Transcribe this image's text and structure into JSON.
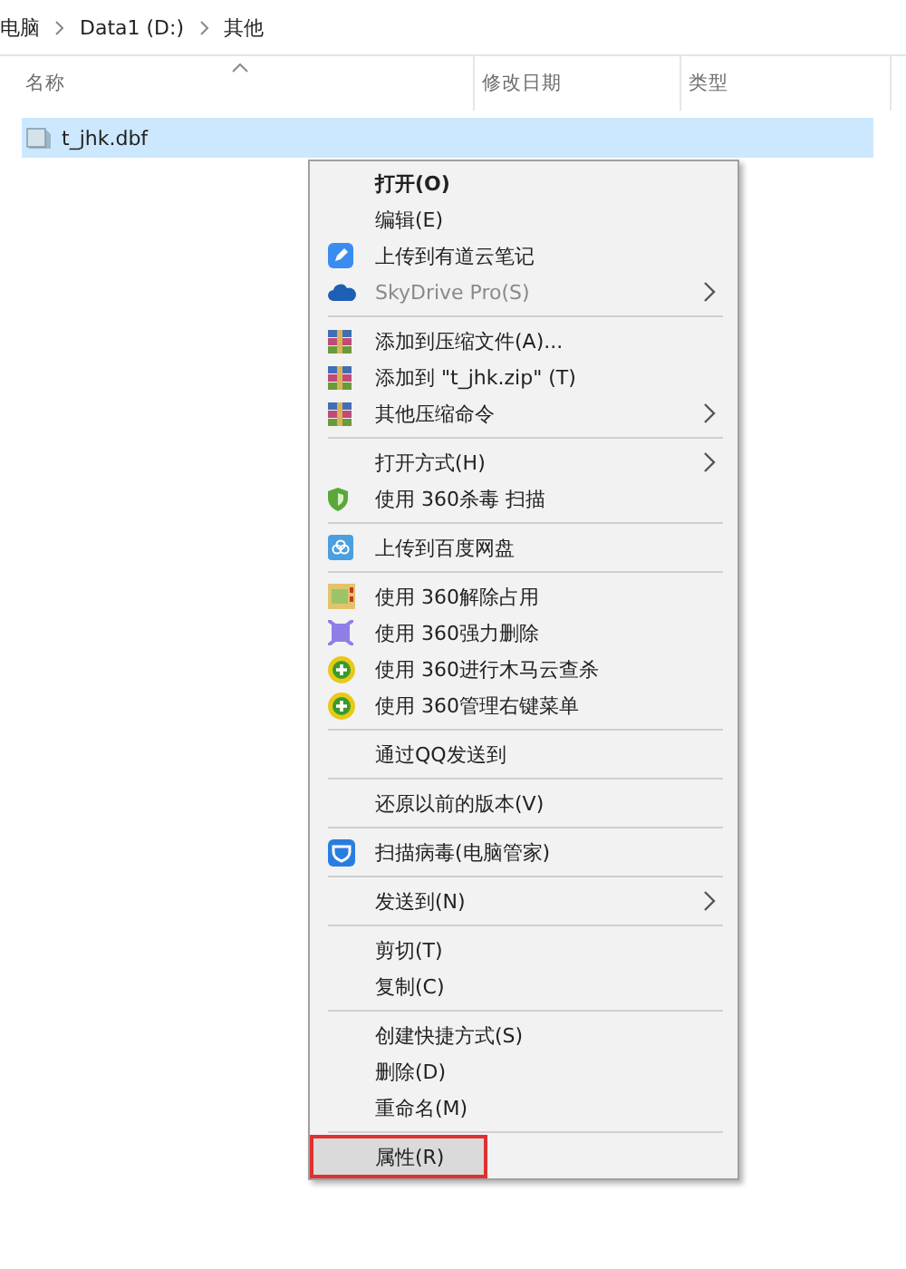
{
  "breadcrumb": [
    "电脑",
    "Data1 (D:)",
    "其他"
  ],
  "columns": [
    "名称",
    "修改日期",
    "类型"
  ],
  "files": [
    {
      "name": "t_jhk.dbf",
      "selected": true
    }
  ],
  "menu": {
    "groups": [
      [
        {
          "label": "打开(O)",
          "bold": true,
          "disabled": false,
          "submenu": false,
          "kind": "plain",
          "selected": false,
          "marked": false
        },
        {
          "label": "编辑(E)",
          "bold": false,
          "disabled": false,
          "submenu": false,
          "kind": "plain",
          "selected": false,
          "marked": false
        },
        {
          "label": "上传到有道云笔记",
          "bold": false,
          "disabled": false,
          "submenu": false,
          "kind": "note",
          "selected": false,
          "marked": false
        },
        {
          "label": "SkyDrive Pro(S)",
          "bold": false,
          "disabled": true,
          "submenu": true,
          "kind": "cloud",
          "selected": false,
          "marked": false
        }
      ],
      [
        {
          "label": "添加到压缩文件(A)...",
          "bold": false,
          "disabled": false,
          "submenu": false,
          "kind": "archive",
          "selected": false,
          "marked": false
        },
        {
          "label": "添加到 \"t_jhk.zip\" (T)",
          "bold": false,
          "disabled": false,
          "submenu": false,
          "kind": "archive",
          "selected": false,
          "marked": false
        },
        {
          "label": "其他压缩命令",
          "bold": false,
          "disabled": false,
          "submenu": true,
          "kind": "archive",
          "selected": false,
          "marked": false
        }
      ],
      [
        {
          "label": "打开方式(H)",
          "bold": false,
          "disabled": false,
          "submenu": true,
          "kind": "plain",
          "selected": false,
          "marked": false
        },
        {
          "label": "使用 360杀毒 扫描",
          "bold": false,
          "disabled": false,
          "submenu": false,
          "kind": "shield",
          "selected": false,
          "marked": false
        }
      ],
      [
        {
          "label": "上传到百度网盘",
          "bold": false,
          "disabled": false,
          "submenu": false,
          "kind": "cloudbox",
          "selected": false,
          "marked": false
        }
      ],
      [
        {
          "label": "使用 360解除占用",
          "bold": false,
          "disabled": false,
          "submenu": false,
          "kind": "unlock",
          "selected": false,
          "marked": false
        },
        {
          "label": "使用 360强力删除",
          "bold": false,
          "disabled": false,
          "submenu": false,
          "kind": "shred",
          "selected": false,
          "marked": false
        },
        {
          "label": "使用 360进行木马云查杀",
          "bold": false,
          "disabled": false,
          "submenu": false,
          "kind": "plus",
          "selected": false,
          "marked": false
        },
        {
          "label": "使用 360管理右键菜单",
          "bold": false,
          "disabled": false,
          "submenu": false,
          "kind": "plus",
          "selected": false,
          "marked": false
        }
      ],
      [
        {
          "label": "通过QQ发送到",
          "bold": false,
          "disabled": false,
          "submenu": false,
          "kind": "plain",
          "selected": false,
          "marked": false
        }
      ],
      [
        {
          "label": "还原以前的版本(V)",
          "bold": false,
          "disabled": false,
          "submenu": false,
          "kind": "plain",
          "selected": false,
          "marked": false
        }
      ],
      [
        {
          "label": "扫描病毒(电脑管家)",
          "bold": false,
          "disabled": false,
          "submenu": false,
          "kind": "guard",
          "selected": false,
          "marked": false
        }
      ],
      [
        {
          "label": "发送到(N)",
          "bold": false,
          "disabled": false,
          "submenu": true,
          "kind": "plain",
          "selected": false,
          "marked": false
        }
      ],
      [
        {
          "label": "剪切(T)",
          "bold": false,
          "disabled": false,
          "submenu": false,
          "kind": "plain",
          "selected": false,
          "marked": false
        },
        {
          "label": "复制(C)",
          "bold": false,
          "disabled": false,
          "submenu": false,
          "kind": "plain",
          "selected": false,
          "marked": false
        }
      ],
      [
        {
          "label": "创建快捷方式(S)",
          "bold": false,
          "disabled": false,
          "submenu": false,
          "kind": "plain",
          "selected": false,
          "marked": false
        },
        {
          "label": "删除(D)",
          "bold": false,
          "disabled": false,
          "submenu": false,
          "kind": "plain",
          "selected": false,
          "marked": false
        },
        {
          "label": "重命名(M)",
          "bold": false,
          "disabled": false,
          "submenu": false,
          "kind": "plain",
          "selected": false,
          "marked": false
        }
      ],
      [
        {
          "label": "属性(R)",
          "bold": false,
          "disabled": false,
          "submenu": false,
          "kind": "plain",
          "selected": true,
          "marked": true
        }
      ]
    ]
  }
}
